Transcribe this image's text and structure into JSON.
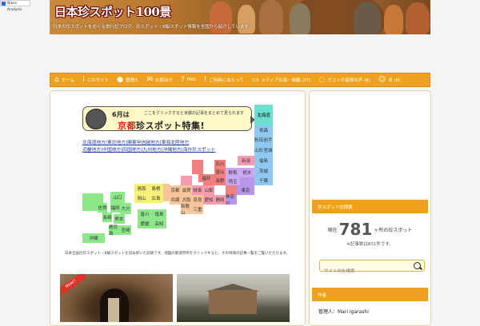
{
  "top_badge": {
    "label": "Nikes Analysis"
  },
  "header": {
    "title": "日本珍スポット100景",
    "subtitle": "日本の珍スポットをめぐる旅行記ブログ。珍スポット・B級スポット情報を全国から紹介しています。"
  },
  "nav": {
    "items": [
      {
        "icon": "home-icon",
        "glyph": "⌂",
        "label": "ホーム"
      },
      {
        "icon": "info-icon",
        "glyph": "i",
        "label": "このサイト"
      },
      {
        "icon": "person-icon",
        "glyph": "●",
        "label": "管理人"
      },
      {
        "icon": "mail-icon",
        "glyph": "✉",
        "label": "お問合せ"
      },
      {
        "icon": "question-icon",
        "glyph": "?",
        "label": "FAQ"
      },
      {
        "icon": "exclamation-icon",
        "glyph": "!",
        "label": "ご利用にあたって"
      },
      {
        "icon": "monitor-icon",
        "glyph": "▭",
        "label": "メディア出演・掲載 (37)"
      },
      {
        "icon": "speech-bubble-icon",
        "glyph": "◌",
        "label": "ゲストの皆様の声 (6)"
      },
      {
        "icon": "smile-icon",
        "glyph": "☺",
        "label": "本 (6)"
      }
    ]
  },
  "promo": {
    "month": "6月は",
    "note": "ここをクリックすると京都の記事をまとめて見られます",
    "big_prefix": "京都",
    "big_suffix": "珍スポット特集!"
  },
  "region_links": {
    "line1": "北海道地方|東北地方|関東甲信越地方|東海北陸地方",
    "line2": "近畿地方|中国地方|四国地方|九州地方|沖縄地方|海外珍スポット"
  },
  "map": {
    "cells": [
      {
        "label": "北海道",
        "color": "teal"
      },
      {
        "label": "青森",
        "color": "blue"
      },
      {
        "label": "秋田",
        "color": "blue"
      },
      {
        "label": "岩手",
        "color": "blue"
      },
      {
        "label": "山形",
        "color": "blue"
      },
      {
        "label": "宮城",
        "color": "blue"
      },
      {
        "label": "新潟",
        "color": "pink"
      },
      {
        "label": "福島",
        "color": "blue"
      },
      {
        "label": "石川",
        "color": "deep"
      },
      {
        "label": "富山",
        "color": "deep"
      },
      {
        "label": "群馬",
        "color": "purple"
      },
      {
        "label": "栃木",
        "color": "purple"
      },
      {
        "label": "茨城",
        "color": "blue"
      },
      {
        "label": "福井",
        "color": "deep"
      },
      {
        "label": "長野",
        "color": "deep"
      },
      {
        "label": "埼玉",
        "color": "purple"
      },
      {
        "label": "千葉",
        "color": "blue"
      },
      {
        "label": "京都",
        "color": "orange"
      },
      {
        "label": "滋賀",
        "color": "orange"
      },
      {
        "label": "岐阜",
        "color": "pink"
      },
      {
        "label": "山梨",
        "color": "pink"
      },
      {
        "label": "東京",
        "color": "violet"
      },
      {
        "label": "兵庫",
        "color": "orange"
      },
      {
        "label": "大阪",
        "color": "orange"
      },
      {
        "label": "奈良",
        "color": "orange"
      },
      {
        "label": "愛知",
        "color": "pink"
      },
      {
        "label": "静岡",
        "color": "pink"
      },
      {
        "label": "神奈川",
        "color": "violet"
      },
      {
        "label": "和歌山",
        "color": "orange"
      },
      {
        "label": "三重",
        "color": "orange"
      },
      {
        "label": "鳥取",
        "color": "yellow"
      },
      {
        "label": "島根",
        "color": "yellow"
      },
      {
        "label": "岡山",
        "color": "yellow"
      },
      {
        "label": "広島",
        "color": "yellow"
      },
      {
        "label": "山口",
        "color": "green"
      },
      {
        "label": "福岡",
        "color": "green"
      },
      {
        "label": "佐賀",
        "color": "green"
      },
      {
        "label": "長崎",
        "color": "green"
      },
      {
        "label": "大分",
        "color": "green"
      },
      {
        "label": "熊本",
        "color": "green"
      },
      {
        "label": "宮崎",
        "color": "green"
      },
      {
        "label": "鹿児島",
        "color": "green"
      },
      {
        "label": "香川",
        "color": "green"
      },
      {
        "label": "徳島",
        "color": "green"
      },
      {
        "label": "愛媛",
        "color": "green"
      },
      {
        "label": "高知",
        "color": "green"
      },
      {
        "label": "沖縄",
        "color": "green"
      }
    ]
  },
  "description": "日本全国の珍スポット・B級スポットを訪ね歩いた記録です。地図の都道府県をクリックすると、その地域の記事一覧をご覧いただけます。",
  "articles": [
    {
      "ribbon": "New!!"
    }
  ],
  "sidebar": {
    "counter_head": "珍スポット訪問数",
    "counter_pre": "現在",
    "counter_num": "781",
    "counter_post": "ヶ所の珍スポット",
    "counter_sub": "※記事数は831件です。",
    "search_placeholder": "サイト内を検索",
    "profile_head": "作者",
    "author": "管理人：Mari Igarashi"
  }
}
